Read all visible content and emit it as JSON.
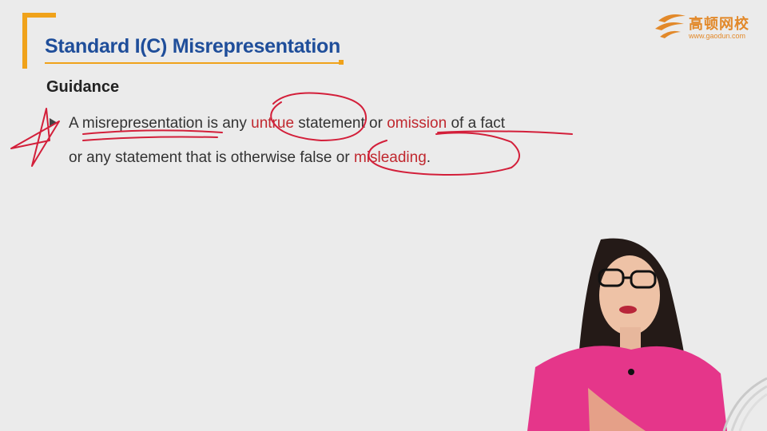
{
  "slide": {
    "title": "Standard I(C) Misrepresentation",
    "section": "Guidance",
    "line1": {
      "t1": "A ",
      "t2": "misrepresentation",
      "t3": " is any ",
      "t4": "untrue",
      "t5": " statement or ",
      "t6": "omission",
      "t7": " of a fact"
    },
    "line2": {
      "t1": "or any statement that is otherwise false or ",
      "t2": "misleading",
      "t3": "."
    }
  },
  "logo": {
    "text_cn": "高顿网校",
    "url": "www.gaodun.com"
  },
  "colors": {
    "title": "#1f4e9a",
    "accent": "#f0a21a",
    "highlight": "#c0282f",
    "annotation": "#d31f3a"
  }
}
